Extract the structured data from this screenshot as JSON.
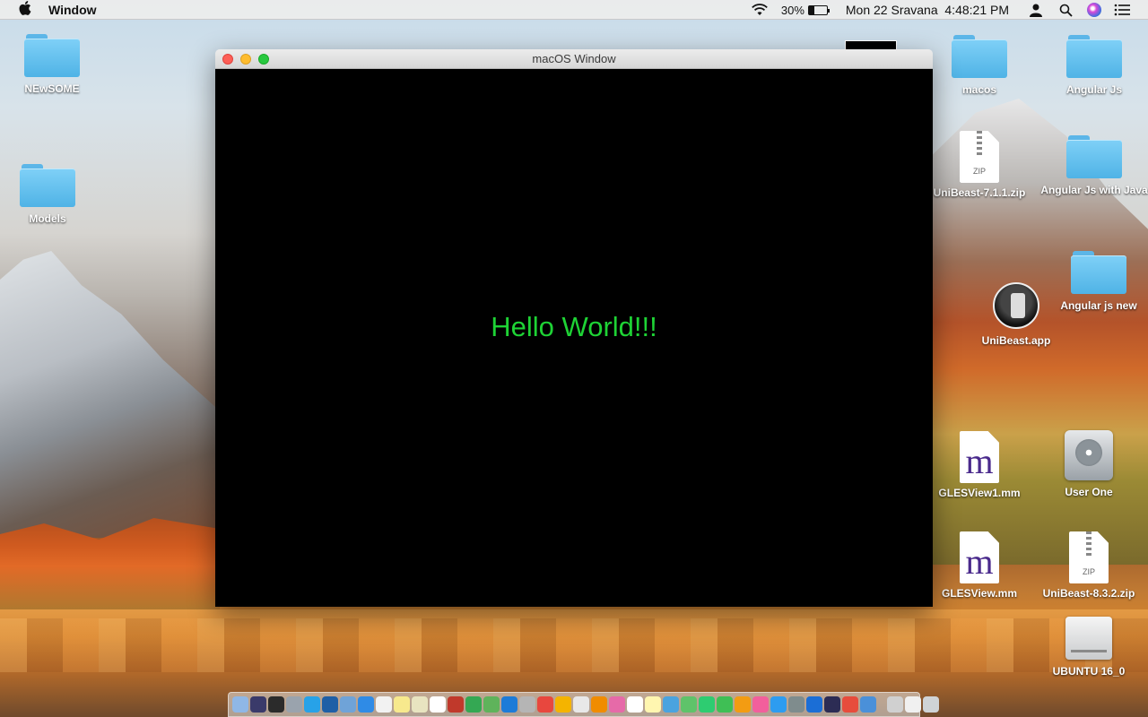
{
  "menubar": {
    "app_name": "Window",
    "battery_percent": "30%",
    "battery_level": 0.3,
    "datetime": "Mon 22 Sravana  4:48:21 PM"
  },
  "window": {
    "title": "macOS Window",
    "content_text": "Hello World!!!",
    "text_color": "#1ed335"
  },
  "desktop": {
    "icons": [
      {
        "label": "NEwSOME",
        "kind": "folder"
      },
      {
        "label": "Models",
        "kind": "folder"
      },
      {
        "label": "macos",
        "kind": "folder"
      },
      {
        "label": "Angular Js",
        "kind": "folder"
      },
      {
        "label": "UniBeast-7.1.1.zip",
        "kind": "zip"
      },
      {
        "label": "Angular Js with Java",
        "kind": "folder"
      },
      {
        "label": "Angular js new",
        "kind": "folder"
      },
      {
        "label": "UniBeast.app",
        "kind": "app"
      },
      {
        "label": "GLESView1.mm",
        "kind": "mm-file"
      },
      {
        "label": "User One",
        "kind": "hard-drive"
      },
      {
        "label": "GLESView.mm",
        "kind": "mm-file"
      },
      {
        "label": "UniBeast-8.3.2.zip",
        "kind": "zip"
      },
      {
        "label": "UBUNTU 16_0",
        "kind": "external-drive"
      }
    ]
  },
  "icons": {
    "zip_label": "ZIP",
    "mm_letter": "m"
  },
  "dock": {
    "apps": [
      "finder",
      "siri",
      "terminal",
      "launchpad",
      "skype",
      "quicktime",
      "preview",
      "safari",
      "textedit",
      "notes",
      "notes2",
      "calendar",
      "photo-booth",
      "utorrent",
      "android-studio",
      "xcode",
      "automator",
      "chrome",
      "chrome2",
      "itunes-file",
      "vlc",
      "photos",
      "textedit2",
      "notes3",
      "finder-window",
      "maps",
      "facetime",
      "messages",
      "books",
      "itunes",
      "app-store",
      "system-preferences",
      "xcode2",
      "eclipse",
      "activity",
      "finder2",
      "preview2",
      "downloads",
      "trash"
    ]
  }
}
